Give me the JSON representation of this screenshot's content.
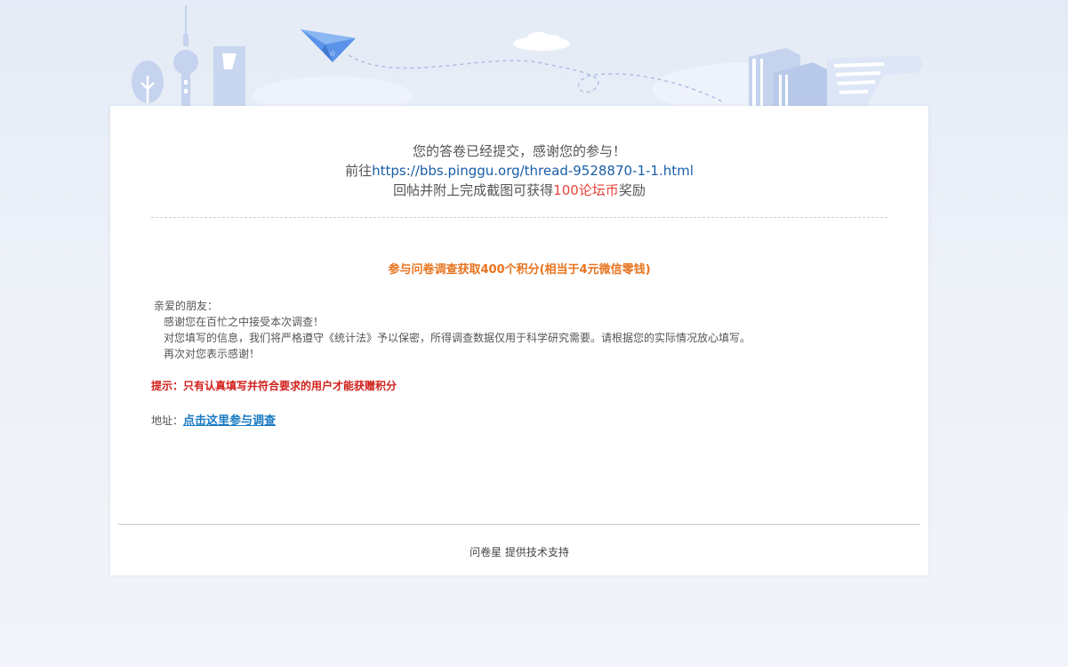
{
  "thanks": {
    "line1": "您的答卷已经提交，感谢您的参与！",
    "line2_prefix": "前往",
    "line2_link": "https://bbs.pinggu.org/thread-9528870-1-1.html",
    "line3_prefix": "回帖并附上完成截图可获得",
    "line3_reward": "100论坛币",
    "line3_suffix": "奖励"
  },
  "content": {
    "headline": "参与问卷调查获取400个积分(相当于4元微信零钱)",
    "greeting": "亲爱的朋友：",
    "para1": "感谢您在百忙之中接受本次调查！",
    "para2": "对您填写的信息，我们将严格遵守《统计法》予以保密，所得调查数据仅用于科学研究需要。请根据您的实际情况放心填写。",
    "para3": "再次对您表示感谢！",
    "tip": "提示：只有认真填写并符合要求的用户才能获赠积分",
    "address_label": "地址：",
    "address_link": "点击这里参与调查"
  },
  "footer": {
    "text": "问卷星 提供技术支持"
  },
  "colors": {
    "link_blue": "#1a5ea8",
    "reward_red": "#e8423a",
    "headline_orange": "#e8731e",
    "tip_red": "#d0201b",
    "illustration_blue": "#c5d3ee"
  }
}
